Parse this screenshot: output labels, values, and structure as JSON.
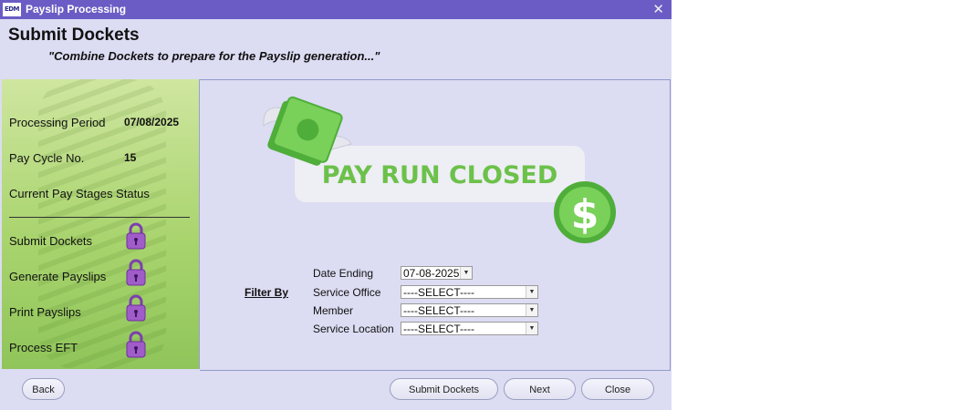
{
  "window": {
    "title": "Payslip Processing",
    "logo_text": "EDM"
  },
  "header": {
    "title": "Submit Dockets",
    "subtitle": "\"Combine Dockets to prepare for the Payslip generation...\""
  },
  "sidebar": {
    "processing_period_label": "Processing Period",
    "processing_period_value": "07/08/2025",
    "pay_cycle_label": "Pay Cycle No.",
    "pay_cycle_value": "15",
    "status_heading": "Current Pay Stages Status",
    "stages": [
      {
        "label": "Submit Dockets",
        "icon": "padlock-icon"
      },
      {
        "label": "Generate Payslips",
        "icon": "padlock-icon"
      },
      {
        "label": "Print Payslips",
        "icon": "padlock-icon"
      },
      {
        "label": "Process EFT",
        "icon": "padlock-icon"
      }
    ]
  },
  "banner": {
    "text": "PAY RUN CLOSED",
    "dollar": "$"
  },
  "filter": {
    "label": "Filter By",
    "date_ending_label": "Date Ending",
    "date_ending_value": "07-08-2025",
    "service_office_label": "Service Office",
    "service_office_value": "----SELECT----",
    "member_label": "Member",
    "member_value": "----SELECT----",
    "service_location_label": "Service Location",
    "service_location_value": "----SELECT----"
  },
  "buttons": {
    "back": "Back",
    "submit": "Submit Dockets",
    "next": "Next",
    "close": "Close"
  },
  "colors": {
    "titlebar": "#6a5cc4",
    "background": "#dcdcf3",
    "banner_green": "#6cc14a",
    "padlock": "#a05cc8"
  }
}
